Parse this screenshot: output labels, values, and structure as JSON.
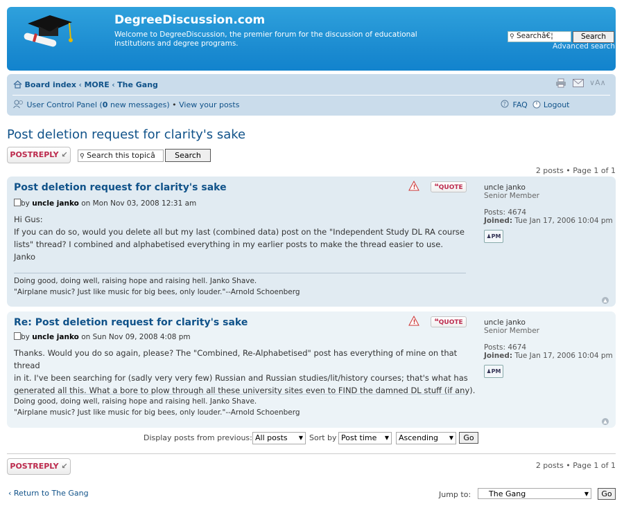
{
  "header": {
    "title": "DegreeDiscussion.com",
    "description": "Welcome to DegreeDiscussion, the premier forum for the discussion of educational institutions and degree programs.",
    "search_value": "Searchâ€¦",
    "search_button": "Search",
    "advanced_search": "Advanced search"
  },
  "nav": {
    "breadcrumb_1": "Board index",
    "breadcrumb_2": "MORE",
    "breadcrumb_3": "The Gang",
    "font_size_control": "A",
    "ucp": "User Control Panel (",
    "new_count": "0",
    "new_messages": " new messages)",
    "bullet": "•",
    "view_posts": "View your posts",
    "faq": "FAQ",
    "logout": "Logout"
  },
  "topic": {
    "title": "Post deletion request for clarity's sake",
    "postreply": "POSTREPLY",
    "search_placeholder": "Search this topicâ",
    "search_button": "Search",
    "pagination_top": "2 posts • Page 1 of 1",
    "pagination_bottom": "2 posts • Page 1 of 1"
  },
  "posts": [
    {
      "title": "Post deletion request for clarity's sake",
      "by": "by",
      "author": "uncle janko",
      "date": " on Mon Nov 03, 2008 12:31 am",
      "quote": "QUOTE",
      "lines": [
        "Hi Gus:",
        "If you can do so, would you delete all but my last (combined data) post on the \"Independent Study DL RA course",
        "lists\" thread? I combined and alphabetised everything in my earlier posts to make the thread easier to use.",
        "Janko"
      ],
      "sig": [
        "Doing good, doing well, raising hope and raising hell. Janko Shave.",
        "\"Airplane music? Just like music for big bees, only louder.\"--Arnold Schoenberg"
      ],
      "profile": {
        "name": "uncle janko",
        "rank": "Senior Member",
        "posts_label": "Posts:",
        "posts": "4674",
        "joined_label": "Joined:",
        "joined": "Tue Jan 17, 2006 10:04 pm",
        "pm": "PM"
      }
    },
    {
      "title": "Re: Post deletion request for clarity's sake",
      "by": "by",
      "author": "uncle janko",
      "date": " on Sun Nov 09, 2008 4:08 pm",
      "quote": "QUOTE",
      "lines": [
        "Thanks. Would you do so again, please? The \"Combined, Re-Alphabetised\" post has everything of mine on that thread",
        "in it. I've been searching for (sadly very very few) Russian and Russian studies/lit/history courses; that's what has",
        "generated all this. What a bore to plow through all these university sites even to FIND the damned DL stuff (if any)."
      ],
      "sig": [
        "Doing good, doing well, raising hope and raising hell. Janko Shave.",
        "\"Airplane music? Just like music for big bees, only louder.\"--Arnold Schoenberg"
      ],
      "profile": {
        "name": "uncle janko",
        "rank": "Senior Member",
        "posts_label": "Posts:",
        "posts": "4674",
        "joined_label": "Joined:",
        "joined": "Tue Jan 17, 2006 10:04 pm",
        "pm": "PM"
      }
    }
  ],
  "sort": {
    "display_label": "Display posts from previous:",
    "display_value": "All posts",
    "sort_label": "Sort by",
    "sort_value": "Post time",
    "order_value": "Ascending",
    "go": "Go"
  },
  "footer": {
    "return_label": "Return to The Gang",
    "jump_label": "Jump to:",
    "jump_value": "The Gang",
    "go": "Go"
  },
  "icons": {
    "logo": "graduation-cap-logo",
    "home": "home-icon",
    "print": "print-icon",
    "email": "email-icon",
    "ucp": "members-icon",
    "faq": "faq-icon",
    "logout": "logout-icon",
    "report": "report-icon",
    "post": "post-icon",
    "top": "back-to-top-icon"
  },
  "colors": {
    "header_blue": "#1a8ad0",
    "navbar": "#cadceb",
    "link": "#105289",
    "post_bg_1": "#e1ebf2",
    "post_bg_2": "#ecf3f7",
    "button_red": "#bc2a4d"
  }
}
